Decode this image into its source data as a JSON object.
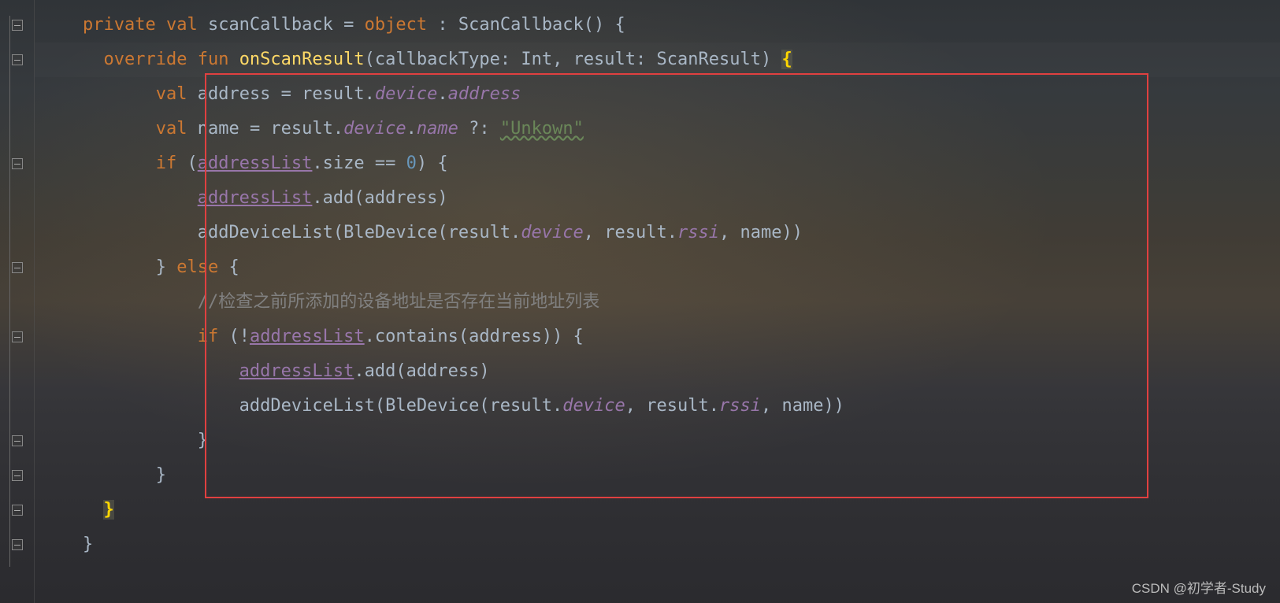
{
  "code": {
    "line1": {
      "kw1": "private",
      "kw2": "val",
      "name": " scanCallback ",
      "op": "=",
      "kw3": " object ",
      "colon": ":",
      "type": " ScanCallback() ",
      "brace": "{"
    },
    "line2": {
      "indent": "    ",
      "kw1": "override",
      "kw2": " fun ",
      "fn": "onScanResult",
      "sig1": "(callbackType: ",
      "type1": "Int",
      "sig2": ", result: ",
      "type2": "ScanResult",
      "sig3": ") ",
      "brace": "{"
    },
    "line3": {
      "indent": "        ",
      "kw": "val",
      "txt1": " address = result.",
      "prop1": "device",
      "dot": ".",
      "prop2": "address"
    },
    "line4": {
      "indent": "        ",
      "kw": "val",
      "txt1": " name = result.",
      "prop1": "device",
      "dot": ".",
      "prop2": "name",
      "elvis": " ?: ",
      "str": "\"Unkown\""
    },
    "line5": {
      "indent": "        ",
      "kw": "if",
      "txt1": " (",
      "field": "addressList",
      "txt2": ".size == ",
      "num": "0",
      "txt3": ") {"
    },
    "line6": {
      "indent": "            ",
      "field": "addressList",
      "txt": ".add(address)"
    },
    "line7": {
      "indent": "            ",
      "txt1": "addDeviceList(BleDevice(result.",
      "prop1": "device",
      "txt2": ", result.",
      "prop2": "rssi",
      "txt3": ", name))"
    },
    "line8": {
      "indent": "        ",
      "txt1": "} ",
      "kw": "else",
      "txt2": " {"
    },
    "line9": {
      "indent": "            ",
      "cmt": "//检查之前所添加的设备地址是否存在当前地址列表"
    },
    "line10": {
      "indent": "            ",
      "kw": "if",
      "txt1": " (!",
      "field": "addressList",
      "txt2": ".contains(address)) {"
    },
    "line11": {
      "indent": "                ",
      "field": "addressList",
      "txt": ".add(address)"
    },
    "line12": {
      "indent": "                ",
      "txt1": "addDeviceList(BleDevice(result.",
      "prop1": "device",
      "txt2": ", result.",
      "prop2": "rssi",
      "txt3": ", name))"
    },
    "line13": {
      "indent": "            ",
      "txt": "}"
    },
    "line14": {
      "indent": "        ",
      "txt": "}"
    },
    "line15": {
      "indent": "    ",
      "txt": "}"
    },
    "line16": {
      "indent": "",
      "txt": "}"
    }
  },
  "watermark": "CSDN @初学者-Study"
}
